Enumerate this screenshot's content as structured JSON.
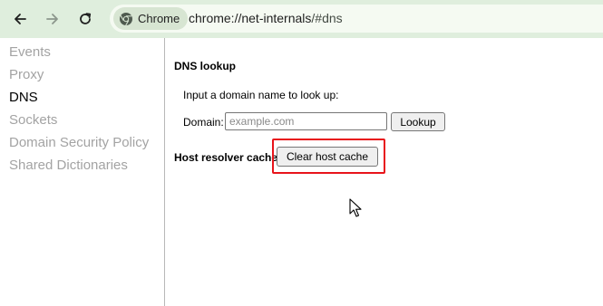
{
  "browser": {
    "back_icon": "arrow-left-icon",
    "forward_icon": "arrow-right-icon",
    "reload_icon": "reload-icon",
    "chip_label": "Chrome",
    "chip_icon": "chrome-logo-icon",
    "url_host": "chrome://net-internals",
    "url_hash": "/#dns"
  },
  "sidebar": {
    "items": [
      {
        "label": "Events",
        "selected": false
      },
      {
        "label": "Proxy",
        "selected": false
      },
      {
        "label": "DNS",
        "selected": true
      },
      {
        "label": "Sockets",
        "selected": false
      },
      {
        "label": "Domain Security Policy",
        "selected": false
      },
      {
        "label": "Shared Dictionaries",
        "selected": false
      }
    ]
  },
  "dns": {
    "lookup_title": "DNS lookup",
    "lookup_prompt": "Input a domain name to look up:",
    "domain_label": "Domain:",
    "domain_value": "",
    "domain_placeholder": "example.com",
    "lookup_button": "Lookup",
    "host_resolver_label": "Host resolver cache",
    "clear_cache_button": "Clear host cache"
  },
  "colors": {
    "toolbar_bg": "#dfeedd",
    "highlight": "#e8141b",
    "inactive_tab": "#a3a3a3"
  }
}
